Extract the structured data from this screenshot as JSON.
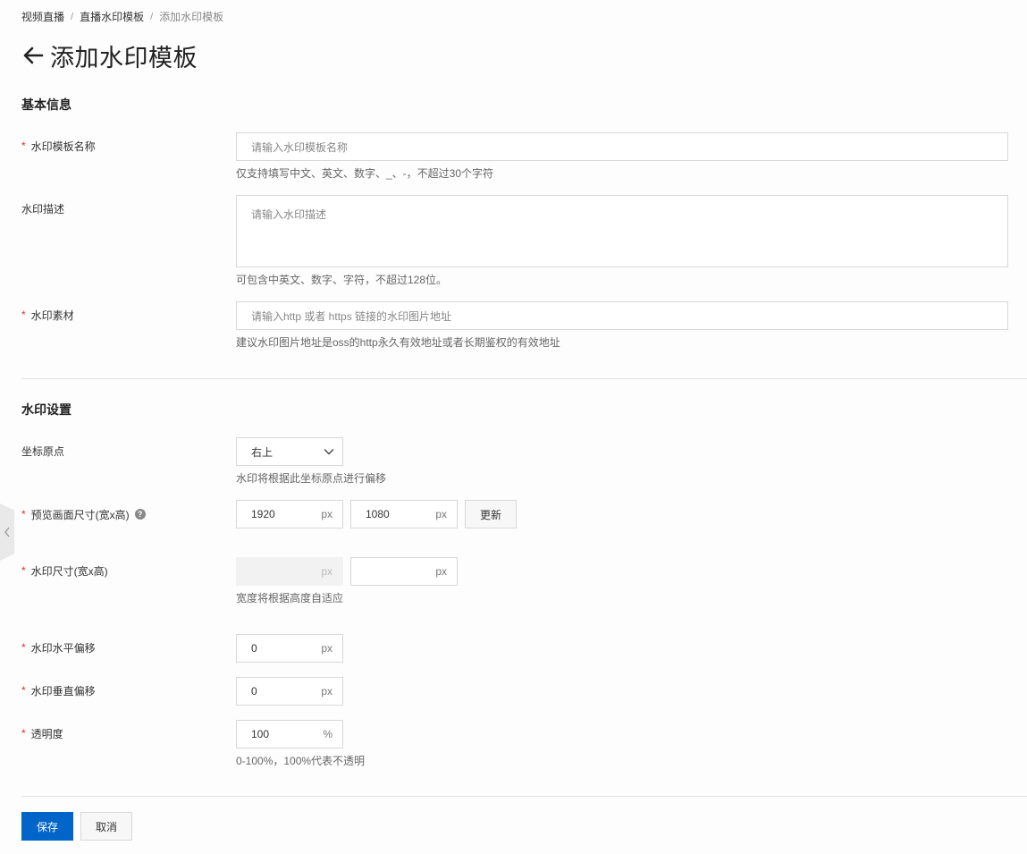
{
  "breadcrumb": {
    "items": [
      "视频直播",
      "直播水印模板"
    ],
    "separator": "/",
    "current": "添加水印模板"
  },
  "header": {
    "title": "添加水印模板"
  },
  "basic_info": {
    "section_title": "基本信息",
    "name": {
      "label": "水印模板名称",
      "placeholder": "请输入水印模板名称",
      "help": "仅支持填写中文、英文、数字、_、-，不超过30个字符"
    },
    "description": {
      "label": "水印描述",
      "placeholder": "请输入水印描述",
      "help": "可包含中英文、数字、字符，不超过128位。"
    },
    "material": {
      "label": "水印素材",
      "placeholder": "请输入http 或者 https 链接的水印图片地址",
      "help": "建议水印图片地址是oss的http永久有效地址或者长期鉴权的有效地址"
    }
  },
  "watermark_settings": {
    "section_title": "水印设置",
    "origin": {
      "label": "坐标原点",
      "value": "右上",
      "help": "水印将根据此坐标原点进行偏移"
    },
    "preview_size": {
      "label": "预览画面尺寸(宽x高)",
      "width": "1920",
      "height": "1080",
      "unit": "px",
      "update_label": "更新"
    },
    "watermark_size": {
      "label": "水印尺寸(宽x高)",
      "width": "",
      "height": "",
      "unit": "px",
      "help": "宽度将根据高度自适应"
    },
    "h_offset": {
      "label": "水印水平偏移",
      "value": "0",
      "unit": "px"
    },
    "v_offset": {
      "label": "水印垂直偏移",
      "value": "0",
      "unit": "px"
    },
    "opacity": {
      "label": "透明度",
      "value": "100",
      "unit": "%",
      "help": "0-100%，100%代表不透明"
    }
  },
  "footer": {
    "save_label": "保存",
    "cancel_label": "取消"
  },
  "colors": {
    "primary": "#0064c8",
    "required": "#d93026"
  }
}
